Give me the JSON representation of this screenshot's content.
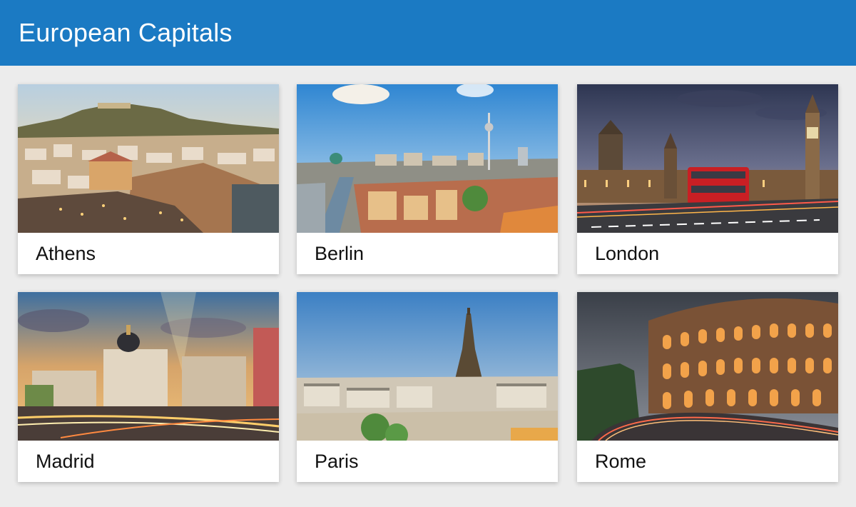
{
  "header": {
    "title": "European Capitals",
    "color": "#1b7ac3"
  },
  "cards": [
    {
      "label": "Athens"
    },
    {
      "label": "Berlin"
    },
    {
      "label": "London"
    },
    {
      "label": "Madrid"
    },
    {
      "label": "Paris"
    },
    {
      "label": "Rome"
    }
  ]
}
